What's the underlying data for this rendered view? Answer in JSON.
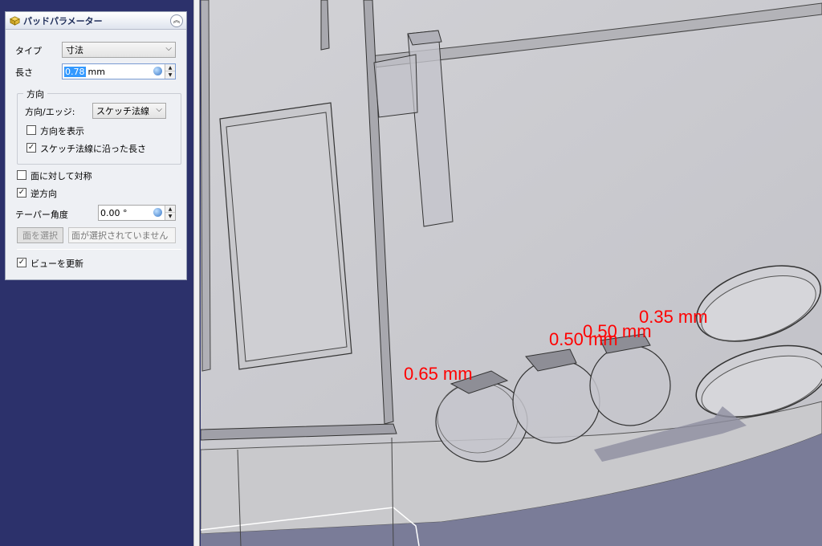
{
  "panel": {
    "title": "パッドパラメーター",
    "collapse_glyph": "︽",
    "type_label": "タイプ",
    "type_value": "寸法",
    "length_label": "長さ",
    "length_value": "0.78",
    "length_unit": "mm",
    "direction_group_label": "方向",
    "direction_edge_label": "方向/エッジ:",
    "direction_edge_value": "スケッチ法線",
    "show_direction_label": "方向を表示",
    "show_direction_checked": false,
    "along_normal_label": "スケッチ法線に沿った長さ",
    "along_normal_checked": true,
    "symmetric_label": "面に対して対称",
    "symmetric_checked": false,
    "reversed_label": "逆方向",
    "reversed_checked": true,
    "taper_label": "テーパー角度",
    "taper_value": "0.00 °",
    "select_face_button": "面を選択",
    "face_field_placeholder": "面が選択されていません",
    "update_view_label": "ビューを更新",
    "update_view_checked": true
  },
  "viewport": {
    "dimension_labels": [
      "0.65 mm",
      "0.50 mm",
      "0.50 mm",
      "0.35 mm"
    ],
    "dimension_color": "#ff0000",
    "background_top": "#c8c8cc",
    "background_bottom": "#5c6090"
  },
  "icons": {
    "panel_icon": "pad-icon",
    "collapse": "chevrons-up-icon",
    "dropdown": "chevron-down-icon",
    "expression": "expression-icon"
  }
}
